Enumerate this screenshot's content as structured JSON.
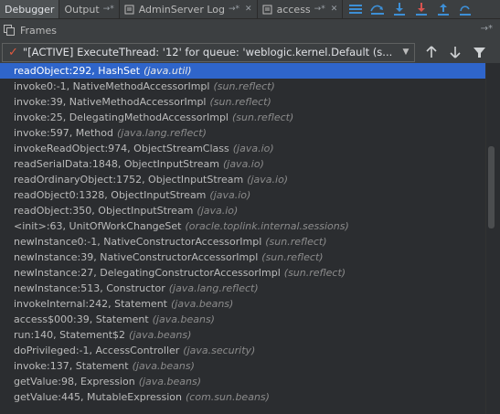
{
  "tabs": [
    {
      "label": "Debugger",
      "active": true
    },
    {
      "label": "Output",
      "pin": "→*"
    },
    {
      "label": "AdminServer Log",
      "pin": "→*"
    },
    {
      "label": "access",
      "pin": "→*"
    }
  ],
  "frames_panel": {
    "title": "Frames",
    "pin_glyph": "→*"
  },
  "thread_selector": {
    "value": "\"[ACTIVE] ExecuteThread: '12' for queue: 'weblogic.kernel.Default (s..."
  },
  "frames": [
    {
      "method": "readObject:292, HashSet",
      "pkg": "(java.util)",
      "selected": true
    },
    {
      "method": "invoke0:-1, NativeMethodAccessorImpl",
      "pkg": "(sun.reflect)"
    },
    {
      "method": "invoke:39, NativeMethodAccessorImpl",
      "pkg": "(sun.reflect)"
    },
    {
      "method": "invoke:25, DelegatingMethodAccessorImpl",
      "pkg": "(sun.reflect)"
    },
    {
      "method": "invoke:597, Method",
      "pkg": "(java.lang.reflect)"
    },
    {
      "method": "invokeReadObject:974, ObjectStreamClass",
      "pkg": "(java.io)"
    },
    {
      "method": "readSerialData:1848, ObjectInputStream",
      "pkg": "(java.io)"
    },
    {
      "method": "readOrdinaryObject:1752, ObjectInputStream",
      "pkg": "(java.io)"
    },
    {
      "method": "readObject0:1328, ObjectInputStream",
      "pkg": "(java.io)"
    },
    {
      "method": "readObject:350, ObjectInputStream",
      "pkg": "(java.io)"
    },
    {
      "method": "<init>:63, UnitOfWorkChangeSet",
      "pkg": "(oracle.toplink.internal.sessions)"
    },
    {
      "method": "newInstance0:-1, NativeConstructorAccessorImpl",
      "pkg": "(sun.reflect)"
    },
    {
      "method": "newInstance:39, NativeConstructorAccessorImpl",
      "pkg": "(sun.reflect)"
    },
    {
      "method": "newInstance:27, DelegatingConstructorAccessorImpl",
      "pkg": "(sun.reflect)"
    },
    {
      "method": "newInstance:513, Constructor",
      "pkg": "(java.lang.reflect)"
    },
    {
      "method": "invokeInternal:242, Statement",
      "pkg": "(java.beans)"
    },
    {
      "method": "access$000:39, Statement",
      "pkg": "(java.beans)"
    },
    {
      "method": "run:140, Statement$2",
      "pkg": "(java.beans)"
    },
    {
      "method": "doPrivileged:-1, AccessController",
      "pkg": "(java.security)"
    },
    {
      "method": "invoke:137, Statement",
      "pkg": "(java.beans)"
    },
    {
      "method": "getValue:98, Expression",
      "pkg": "(java.beans)"
    },
    {
      "method": "getValue:445, MutableExpression",
      "pkg": "(com.sun.beans)"
    }
  ],
  "colors": {
    "selection": "#2f65ca",
    "active_thread_check": "#e05a40",
    "step_icons": "#3d8fd6",
    "red_step": "#d9534f"
  }
}
